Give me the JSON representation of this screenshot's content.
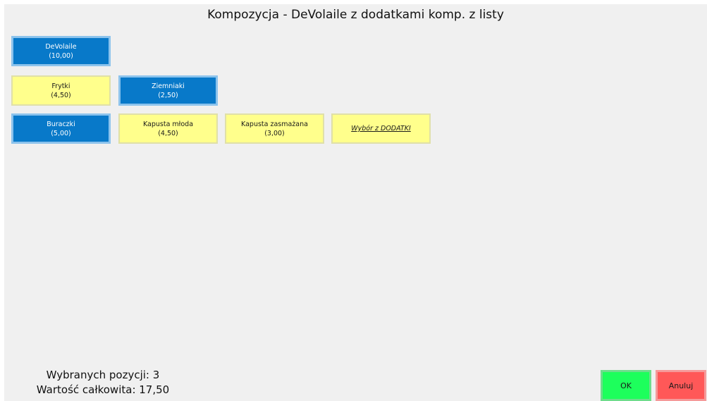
{
  "dialog": {
    "title": "Kompozycja - DeVolaile z dodatkami komp. z listy"
  },
  "tiles": {
    "devolaile": {
      "name": "DeVolaile",
      "price": "(10,00)",
      "selected": true
    },
    "frytki": {
      "name": "Frytki",
      "price": "(4,50)",
      "selected": false
    },
    "ziemniaki": {
      "name": "Ziemniaki",
      "price": "(2,50)",
      "selected": true
    },
    "buraczki": {
      "name": "Buraczki",
      "price": "(5,00)",
      "selected": true
    },
    "kapusta_mloda": {
      "name": "Kapusta młoda",
      "price": "(4,50)",
      "selected": false
    },
    "kapusta_zasmazana": {
      "name": "Kapusta zasmażana",
      "price": "(3,00)",
      "selected": false
    },
    "wybor_dodatki": {
      "label": "Wybór z DODATKI"
    }
  },
  "summary": {
    "selected_count_text": "Wybranych pozycji: 3",
    "total_value_text": "Wartość całkowita: 17,50"
  },
  "buttons": {
    "ok_label": "OK",
    "cancel_label": "Anuluj"
  },
  "colors": {
    "selected_tile": "#0879c9",
    "unselected_tile": "#ffff8c",
    "ok_button": "#1dff5c",
    "cancel_button": "#ff5858",
    "background": "#f0f0f0"
  }
}
